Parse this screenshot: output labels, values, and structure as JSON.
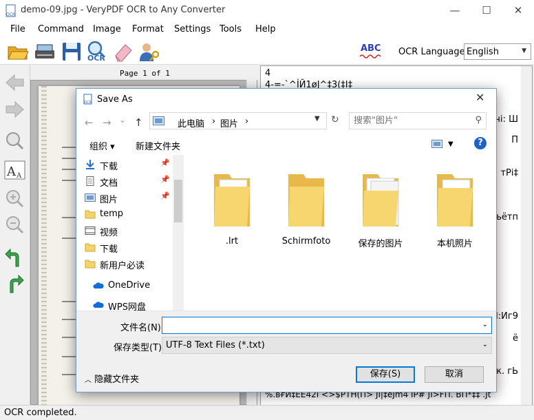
{
  "window": {
    "title": "demo-09.jpg - VeryPDF OCR to Any Converter",
    "minimize": "—",
    "maximize": "☐",
    "close": "✕"
  },
  "menu": [
    "File",
    "Command",
    "Image",
    "Format",
    "Settings",
    "Tools",
    "Help"
  ],
  "toolbar": {
    "icons": [
      "open-folder",
      "scanner",
      "save",
      "ocr",
      "eraser",
      "user-key"
    ],
    "ocr_caption": "OCR",
    "spell_caption": "ABC",
    "ocr_language_label": "OCR Language",
    "ocr_language_value": "English"
  },
  "viewer": {
    "page_label": "Page 1 of 1"
  },
  "text_panel": {
    "lines_left": [
      "4",
      "4-=-`^İЙ1øJ^‡3(‡I‡"
    ],
    "line_bottom": "%.вғӢ‡ЕЕ42I <>$PTH(П> Jl|‡eJm4  IP# JI>FП. ВП*‡‡ .Jt",
    "right_fragments": [
      "тчі: Ш",
      "П",
      "тРі‡",
      "ъётп",
      "I:Иг9",
      "ё",
      "тк. гЬ",
      " "
    ]
  },
  "status": {
    "text": "OCR completed."
  },
  "dialog": {
    "title": "Save As",
    "close": "✕",
    "nav_back": "←",
    "nav_forward": "→",
    "nav_recent": "⌄",
    "nav_up": "↑",
    "address": [
      "此电脑",
      "›",
      "图片",
      "›"
    ],
    "search_placeholder": "搜索\"图片\"",
    "organize": "组织 ▾",
    "new_folder": "新建文件夹",
    "help": "?",
    "nav_items": [
      {
        "label": "下载",
        "pinned": true
      },
      {
        "label": "文档",
        "pinned": true
      },
      {
        "label": "图片",
        "pinned": true
      },
      {
        "label": "temp",
        "pinned": false
      },
      {
        "label": "视频",
        "pinned": false
      },
      {
        "label": "下载",
        "pinned": false
      },
      {
        "label": "新用户必读",
        "pinned": false
      },
      {
        "label": "OneDrive",
        "pinned": false
      },
      {
        "label": "WPS网盘",
        "pinned": false
      }
    ],
    "folders": [
      ".lrt",
      "Schirmfoto",
      "保存的图片",
      "本机照片"
    ],
    "filename_label": "文件名(N):",
    "filename_value": "",
    "filetype_label": "保存类型(T):",
    "filetype_value": "UTF-8 Text Files (*.txt)",
    "hide_folders": "隐藏文件夹",
    "save_button": "保存(S)",
    "cancel_button": "取消"
  }
}
